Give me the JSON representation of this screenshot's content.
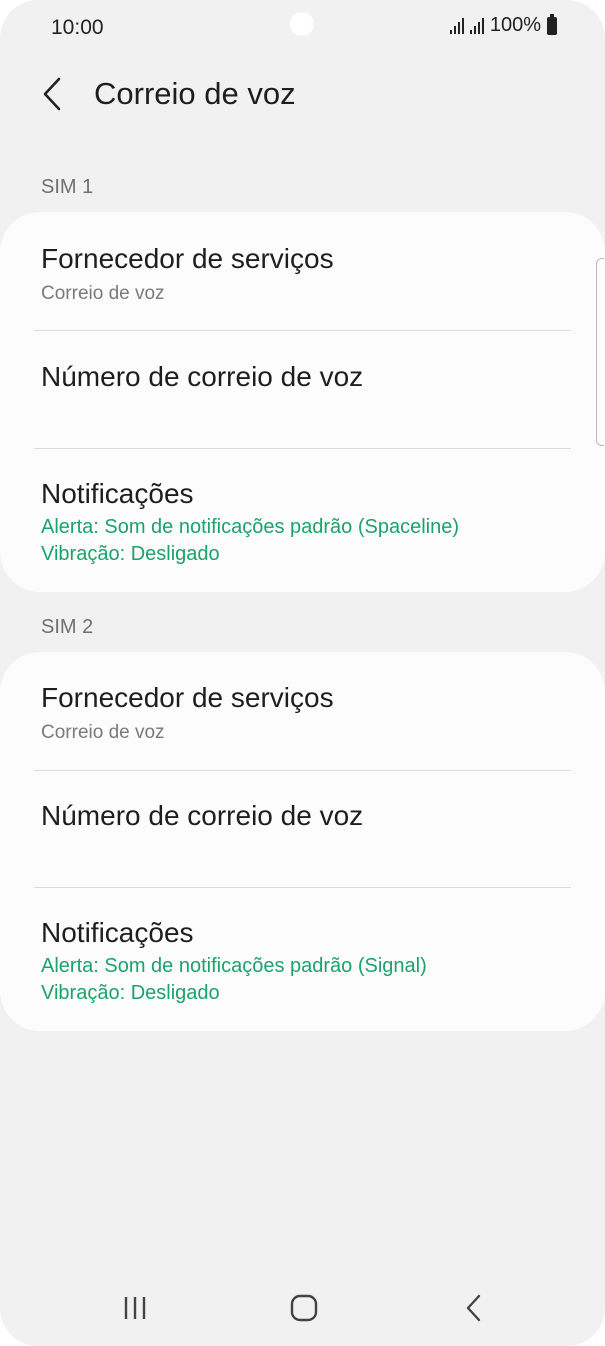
{
  "status_bar": {
    "time": "10:00",
    "battery": "100%",
    "icons": [
      "signal-sim1-icon",
      "signal-sim2-icon",
      "battery-icon"
    ]
  },
  "header": {
    "title": "Correio de voz",
    "back_icon": "chevron-left-icon"
  },
  "sections": [
    {
      "label": "SIM 1",
      "items": [
        {
          "title": "Fornecedor de serviços",
          "subtitle": "Correio de voz"
        },
        {
          "title": "Número de correio de voz"
        },
        {
          "title": "Notificações",
          "alert": "Alerta: Som de notificações padrão (Spaceline)",
          "vibration": "Vibração: Desligado"
        }
      ]
    },
    {
      "label": "SIM 2",
      "items": [
        {
          "title": "Fornecedor de serviços",
          "subtitle": "Correio de voz"
        },
        {
          "title": "Número de correio de voz"
        },
        {
          "title": "Notificações",
          "alert": "Alerta: Som de notificações padrão (Signal)",
          "vibration": "Vibração: Desligado"
        }
      ]
    }
  ],
  "colors": {
    "background": "#f1f1f1",
    "card": "#fcfcfc",
    "accent_green": "#1aa36a",
    "text_primary": "#1e1e1e",
    "text_secondary": "#7a7a7a"
  },
  "nav_bar": {
    "icons": [
      "recent-apps-icon",
      "home-icon",
      "back-icon"
    ]
  }
}
